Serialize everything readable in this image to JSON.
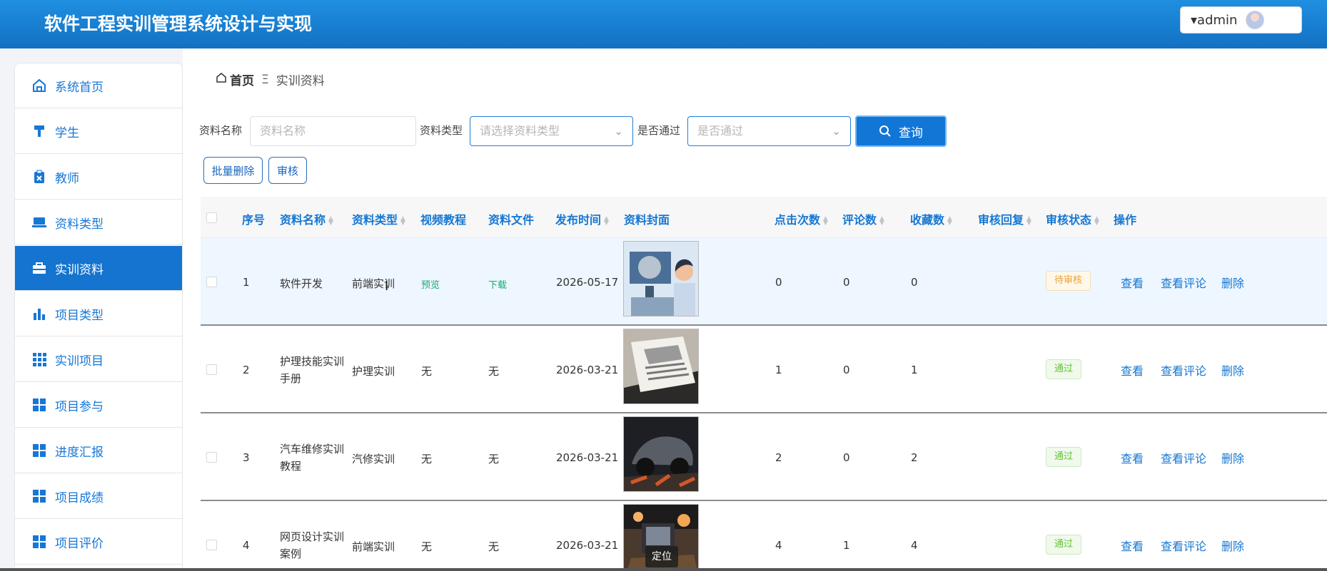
{
  "app": {
    "title": "软件工程实训管理系统设计与实现"
  },
  "user": {
    "name": "▾admin"
  },
  "sidebar": {
    "items": [
      {
        "label": "系统首页",
        "icon": "home-icon",
        "active": false
      },
      {
        "label": "学生",
        "icon": "brush-icon",
        "active": false
      },
      {
        "label": "教师",
        "icon": "clipboard-icon",
        "active": false
      },
      {
        "label": "资料类型",
        "icon": "laptop-icon",
        "active": false
      },
      {
        "label": "实训资料",
        "icon": "briefcase-icon",
        "active": true
      },
      {
        "label": "项目类型",
        "icon": "bar-chart-icon",
        "active": false
      },
      {
        "label": "实训项目",
        "icon": "grid-icon",
        "active": false
      },
      {
        "label": "项目参与",
        "icon": "dashboard-grid-icon",
        "active": false
      },
      {
        "label": "进度汇报",
        "icon": "dashboard-grid-icon",
        "active": false
      },
      {
        "label": "项目成绩",
        "icon": "dashboard-grid-icon",
        "active": false
      },
      {
        "label": "项目评价",
        "icon": "dashboard-grid-icon",
        "active": false
      }
    ]
  },
  "breadcrumb": {
    "home": "首页",
    "separator": "Ξ",
    "current": "实训资料"
  },
  "search": {
    "name_label": "资料名称",
    "name_placeholder": "资料名称",
    "type_label": "资料类型",
    "type_placeholder": "请选择资料类型",
    "passed_label": "是否通过",
    "passed_placeholder": "是否通过",
    "button": "查询"
  },
  "actions": {
    "batch_delete": "批量删除",
    "review": "审核"
  },
  "table": {
    "headers": [
      "序号",
      "资料名称",
      "资料类型",
      "视频教程",
      "资料文件",
      "发布时间",
      "资料封面",
      "点击次数",
      "评论数",
      "收藏数",
      "审核回复",
      "审核状态",
      "操作"
    ],
    "rows": [
      {
        "id": "1",
        "name": "软件开发",
        "type": "前端实训",
        "video": "预览",
        "file": "下载",
        "date": "2026-05-17",
        "clicks": "0",
        "comments": "0",
        "favorites": "0",
        "status": "待审核",
        "status_type": "pending"
      },
      {
        "id": "2",
        "name": "护理技能实训手册",
        "type": "护理实训",
        "video": "无",
        "file": "无",
        "date": "2026-03-21",
        "clicks": "1",
        "comments": "0",
        "favorites": "1",
        "status": "通过",
        "status_type": "pass"
      },
      {
        "id": "3",
        "name": "汽车维修实训教程",
        "type": "汽修实训",
        "video": "无",
        "file": "无",
        "date": "2026-03-21",
        "clicks": "2",
        "comments": "0",
        "favorites": "2",
        "status": "通过",
        "status_type": "pass"
      },
      {
        "id": "4",
        "name": "网页设计实训案例",
        "type": "前端实训",
        "video": "无",
        "file": "无",
        "date": "2026-03-21",
        "clicks": "4",
        "comments": "1",
        "favorites": "4",
        "status": "通过",
        "status_type": "pass"
      }
    ],
    "operations": {
      "view": "查看",
      "view_comments": "查看评论",
      "delete": "删除"
    }
  },
  "tooltip": "定位",
  "colors": {
    "primary": "#1474cf",
    "link": "#1677d2",
    "success": "#67c23a",
    "warning": "#e6a23c"
  }
}
